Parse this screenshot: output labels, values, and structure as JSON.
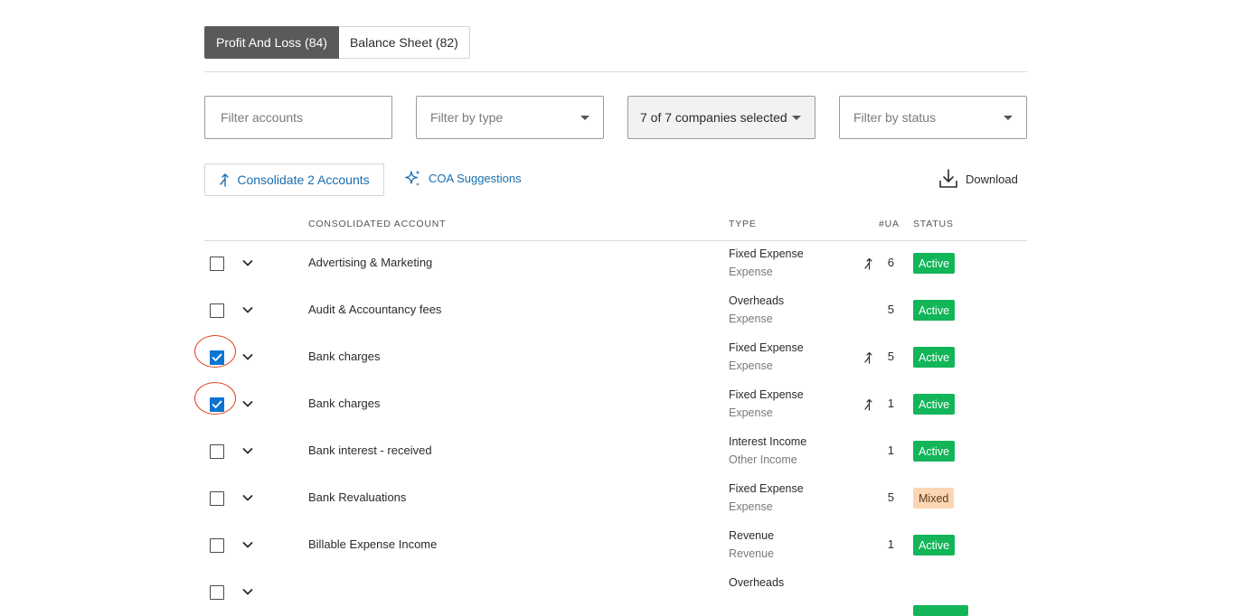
{
  "tabs": [
    {
      "label": "Profit And Loss (84)",
      "active": true
    },
    {
      "label": "Balance Sheet (82)",
      "active": false
    }
  ],
  "filters": {
    "accounts_placeholder": "Filter accounts",
    "type_placeholder": "Filter by type",
    "companies_value": "7 of 7 companies selected",
    "status_placeholder": "Filter by status"
  },
  "actions": {
    "consolidate_label": "Consolidate 2 Accounts",
    "coa_label": "COA Suggestions",
    "download_label": "Download"
  },
  "columns": {
    "account": "CONSOLIDATED ACCOUNT",
    "type": "TYPE",
    "ua": "#UA",
    "status": "STATUS"
  },
  "rows": [
    {
      "checked": false,
      "account": "Advertising & Marketing",
      "type": "Fixed Expense",
      "subtype": "Expense",
      "merge_icon": true,
      "ua": "6",
      "status": "Active",
      "status_kind": "active"
    },
    {
      "checked": false,
      "account": "Audit & Accountancy fees",
      "type": "Overheads",
      "subtype": "Expense",
      "merge_icon": false,
      "ua": "5",
      "status": "Active",
      "status_kind": "active"
    },
    {
      "checked": true,
      "account": "Bank charges",
      "type": "Fixed Expense",
      "subtype": "Expense",
      "merge_icon": true,
      "ua": "5",
      "status": "Active",
      "status_kind": "active"
    },
    {
      "checked": true,
      "account": "Bank charges",
      "type": "Fixed Expense",
      "subtype": "Expense",
      "merge_icon": true,
      "ua": "1",
      "status": "Active",
      "status_kind": "active"
    },
    {
      "checked": false,
      "account": "Bank interest - received",
      "type": "Interest Income",
      "subtype": "Other Income",
      "merge_icon": false,
      "ua": "1",
      "status": "Active",
      "status_kind": "active"
    },
    {
      "checked": false,
      "account": "Bank Revaluations",
      "type": "Fixed Expense",
      "subtype": "Expense",
      "merge_icon": false,
      "ua": "5",
      "status": "Mixed",
      "status_kind": "mixed"
    },
    {
      "checked": false,
      "account": "Billable Expense Income",
      "type": "Revenue",
      "subtype": "Revenue",
      "merge_icon": false,
      "ua": "1",
      "status": "Active",
      "status_kind": "active"
    },
    {
      "checked": false,
      "account": "",
      "type": "Overheads",
      "subtype": "",
      "merge_icon": false,
      "ua": "",
      "status": "",
      "status_kind": "active"
    }
  ],
  "colors": {
    "accent": "#1a6fb0",
    "checkbox_checked": "#0b74d1",
    "active_badge": "#12b558",
    "mixed_badge": "#fcd5b3",
    "highlight_ring": "#e0431e"
  },
  "icons": {
    "consolidate": "merge-arrow-icon",
    "coa": "sparkle-icon",
    "download": "download-icon",
    "expand": "chevron-down-icon",
    "consolidated_marker": "merge-icon"
  }
}
